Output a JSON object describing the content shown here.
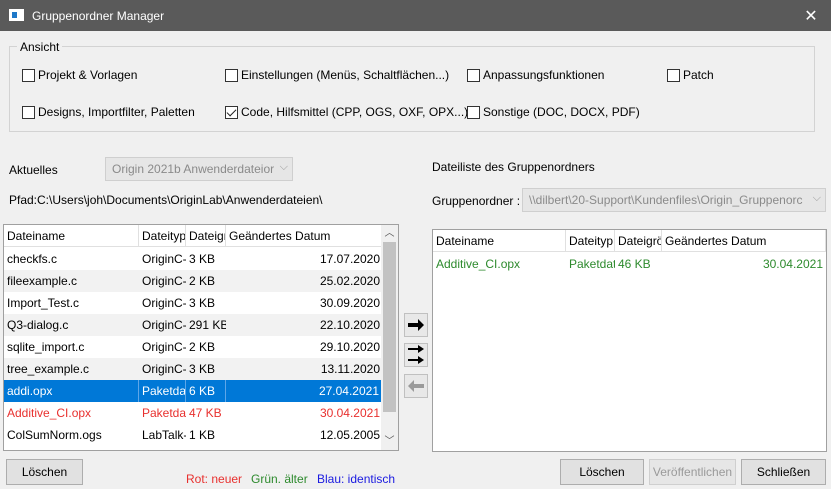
{
  "window": {
    "title": "Gruppenordner Manager",
    "close_glyph": "✕"
  },
  "ansicht": {
    "label": "Ansicht",
    "options": [
      {
        "label": "Projekt & Vorlagen",
        "checked": false
      },
      {
        "label": "Einstellungen (Menüs, Schaltflächen...)",
        "checked": false
      },
      {
        "label": "Anpassungsfunktionen",
        "checked": false
      },
      {
        "label": "Patch",
        "checked": false
      },
      {
        "label": "Designs, Importfilter, Paletten",
        "checked": false
      },
      {
        "label": "Code, Hilfsmittel (CPP, OGS, OXF, OPX...)",
        "checked": true
      },
      {
        "label": "Sonstige (DOC, DOCX, PDF)",
        "checked": false
      }
    ]
  },
  "left": {
    "aktuelles_label": "Aktuelles",
    "aktuelles_value": "Origin 2021b Anwenderdateior",
    "pfad": "Pfad:C:\\Users\\joh\\Documents\\OriginLab\\Anwenderdateien\\",
    "columns": [
      "Dateiname",
      "Dateityp",
      "Dateigrö",
      "Geändertes Datum"
    ],
    "rows": [
      {
        "name": "checkfs.c",
        "type": "OriginC-",
        "size": "3 KB",
        "date": "17.07.2020",
        "style": ""
      },
      {
        "name": "fileexample.c",
        "type": "OriginC-",
        "size": "2 KB",
        "date": "25.02.2020",
        "style": "alt"
      },
      {
        "name": "Import_Test.c",
        "type": "OriginC-",
        "size": "3 KB",
        "date": "30.09.2020",
        "style": ""
      },
      {
        "name": "Q3-dialog.c",
        "type": "OriginC-",
        "size": "291 KB",
        "date": "22.10.2020",
        "style": "alt"
      },
      {
        "name": "sqlite_import.c",
        "type": "OriginC-",
        "size": "2 KB",
        "date": "29.10.2020",
        "style": ""
      },
      {
        "name": "tree_example.c",
        "type": "OriginC-",
        "size": "3 KB",
        "date": "13.11.2020",
        "style": "alt"
      },
      {
        "name": "addi.opx",
        "type": "Paketdat",
        "size": "6 KB",
        "date": "27.04.2021",
        "style": "sel"
      },
      {
        "name": "Additive_CI.opx",
        "type": "Paketdat",
        "size": "47 KB",
        "date": "30.04.2021",
        "style": "red"
      },
      {
        "name": "ColSumNorm.ogs",
        "type": "LabTalk-",
        "size": "1 KB",
        "date": "12.05.2005",
        "style": ""
      }
    ],
    "delete_label": "Löschen"
  },
  "legend": {
    "red": {
      "text": "Rot: neuer",
      "color": "#e8302e"
    },
    "green": {
      "text": "Grün. älter",
      "color": "#2d8a2d"
    },
    "blue": {
      "text": "Blau: identisch",
      "color": "#1a1ae0"
    }
  },
  "right": {
    "title": "Dateiliste des Gruppenordners",
    "gruppenordner_label": "Gruppenordner :",
    "gruppenordner_value": "\\\\dilbert\\20-Support\\Kundenfiles\\Origin_Gruppenorc",
    "columns": [
      "Dateiname",
      "Dateityp",
      "Dateigrö",
      "Geändertes Datum"
    ],
    "rows": [
      {
        "name": "Additive_CI.opx",
        "type": "Paketdat",
        "size": "46 KB",
        "date": "30.04.2021",
        "style": "green"
      }
    ],
    "delete_label": "Löschen",
    "publish_label": "Veröffentlichen",
    "close_label": "Schließen"
  }
}
